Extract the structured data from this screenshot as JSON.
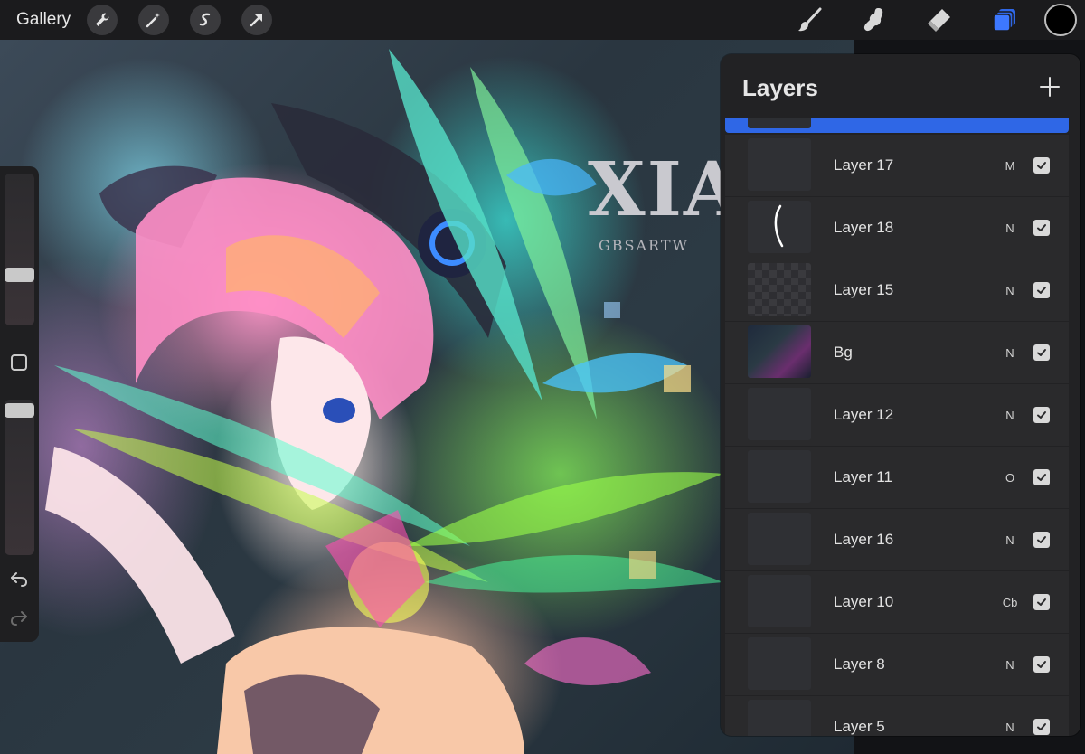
{
  "topbar": {
    "gallery_label": "Gallery",
    "tools_left": [
      "wrench-icon",
      "magic-wand-icon",
      "selection-icon",
      "transform-arrow-icon"
    ],
    "tools_right": [
      "brush-icon",
      "smudge-icon",
      "eraser-icon",
      "layers-icon"
    ],
    "active_tool": "layers-icon",
    "accent_color": "#2f67e6",
    "current_color": "#000000"
  },
  "artwork": {
    "watermark": "XIA",
    "watermark_sub": "GBSARTW"
  },
  "sidebar": {
    "brush_size": 0.42,
    "opacity": 0.9
  },
  "layers_panel": {
    "title": "Layers",
    "add_label": "+",
    "layers": [
      {
        "name": "Layer 17",
        "blend": "M",
        "visible": true
      },
      {
        "name": "Layer 18",
        "blend": "N",
        "visible": true
      },
      {
        "name": "Layer 15",
        "blend": "N",
        "visible": true
      },
      {
        "name": "Bg",
        "blend": "N",
        "visible": true
      },
      {
        "name": "Layer 12",
        "blend": "N",
        "visible": true
      },
      {
        "name": "Layer 11",
        "blend": "O",
        "visible": true
      },
      {
        "name": "Layer 16",
        "blend": "N",
        "visible": true
      },
      {
        "name": "Layer 10",
        "blend": "Cb",
        "visible": true
      },
      {
        "name": "Layer 8",
        "blend": "N",
        "visible": true
      },
      {
        "name": "Layer 5",
        "blend": "N",
        "visible": true
      }
    ]
  }
}
